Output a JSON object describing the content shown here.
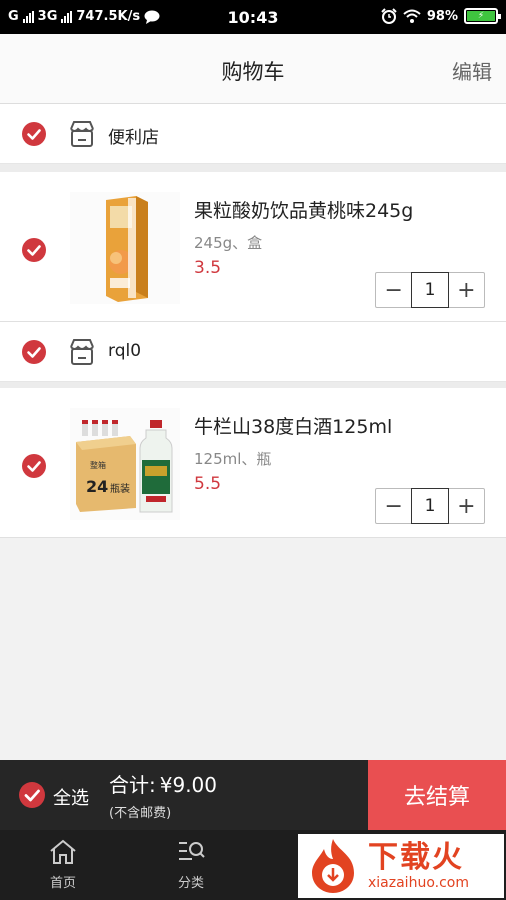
{
  "status_bar": {
    "carrier": "G",
    "network": "3G",
    "speed": "747.5K/s",
    "time": "10:43",
    "battery": "98%"
  },
  "header": {
    "title": "购物车",
    "edit_label": "编辑"
  },
  "cart": {
    "stores": [
      {
        "name": "便利店",
        "items": [
          {
            "name": "果粒酸奶饮品黄桃味245g",
            "spec": "245g、盒",
            "price": "3.5",
            "quantity": "1"
          }
        ]
      },
      {
        "name": "rql0",
        "items": [
          {
            "name": "牛栏山38度白酒125ml",
            "spec": "125ml、瓶",
            "price": "5.5",
            "quantity": "1",
            "box_text_top": "整箱",
            "box_text_number": "24",
            "box_text_bottom": "瓶装"
          }
        ]
      }
    ]
  },
  "checkout": {
    "select_all_label": "全选",
    "total_label": "合计:",
    "total_amount": "¥9.00",
    "shipping_note": "(不含邮费)",
    "checkout_label": "去结算"
  },
  "tabbar": {
    "tabs": [
      {
        "label": "首页",
        "icon": "home-icon"
      },
      {
        "label": "分类",
        "icon": "category-search-icon"
      }
    ]
  },
  "watermark": {
    "title": "下载火",
    "url": "xiazaihuo.com"
  },
  "colors": {
    "accent": "#d0383e",
    "checkout_button": "#e94f51",
    "bottom_bar": "#262626"
  }
}
